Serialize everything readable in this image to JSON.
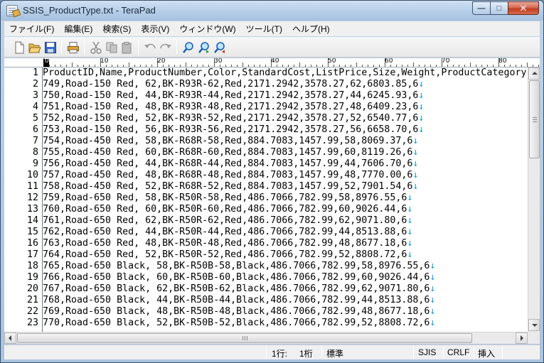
{
  "window": {
    "title": "SSIS_ProductType.txt - TeraPad"
  },
  "window_buttons": {
    "minimize": "—",
    "maximize": "□",
    "close": "✕"
  },
  "menu": [
    "ファイル(F)",
    "編集(E)",
    "検索(S)",
    "表示(V)",
    "ウィンドウ(W)",
    "ツール(T)",
    "ヘルプ(H)"
  ],
  "toolbar_icons": [
    "new-file-icon",
    "open-folder-icon",
    "save-icon",
    "print-icon",
    "cut-icon",
    "copy-icon",
    "paste-icon",
    "undo-icon",
    "redo-icon",
    "find-icon",
    "find-next-icon",
    "find-previous-icon"
  ],
  "ruler": {
    "labels": [
      "0",
      "10",
      "20",
      "30",
      "40",
      "50",
      "60",
      "70",
      "80"
    ]
  },
  "editor": {
    "eol_mark": "↓",
    "lines": [
      {
        "n": "1",
        "text": "ProductID,Name,ProductNumber,Color,StandardCost,ListPrice,Size,Weight,ProductCategory",
        "eol": false
      },
      {
        "n": "2",
        "text": "749,Road-150 Red, 62,BK-R93R-62,Red,2171.2942,3578.27,62,6803.85,6",
        "eol": true
      },
      {
        "n": "3",
        "text": "750,Road-150 Red, 44,BK-R93R-44,Red,2171.2942,3578.27,44,6245.93,6",
        "eol": true
      },
      {
        "n": "4",
        "text": "751,Road-150 Red, 48,BK-R93R-48,Red,2171.2942,3578.27,48,6409.23,6",
        "eol": true
      },
      {
        "n": "5",
        "text": "752,Road-150 Red, 52,BK-R93R-52,Red,2171.2942,3578.27,52,6540.77,6",
        "eol": true
      },
      {
        "n": "6",
        "text": "753,Road-150 Red, 56,BK-R93R-56,Red,2171.2942,3578.27,56,6658.70,6",
        "eol": true
      },
      {
        "n": "7",
        "text": "754,Road-450 Red, 58,BK-R68R-58,Red,884.7083,1457.99,58,8069.37,6",
        "eol": true
      },
      {
        "n": "8",
        "text": "755,Road-450 Red, 60,BK-R68R-60,Red,884.7083,1457.99,60,8119.26,6",
        "eol": true
      },
      {
        "n": "9",
        "text": "756,Road-450 Red, 44,BK-R68R-44,Red,884.7083,1457.99,44,7606.70,6",
        "eol": true
      },
      {
        "n": "10",
        "text": "757,Road-450 Red, 48,BK-R68R-48,Red,884.7083,1457.99,48,7770.00,6",
        "eol": true
      },
      {
        "n": "11",
        "text": "758,Road-450 Red, 52,BK-R68R-52,Red,884.7083,1457.99,52,7901.54,6",
        "eol": true
      },
      {
        "n": "12",
        "text": "759,Road-650 Red, 58,BK-R50R-58,Red,486.7066,782.99,58,8976.55,6",
        "eol": true
      },
      {
        "n": "13",
        "text": "760,Road-650 Red, 60,BK-R50R-60,Red,486.7066,782.99,60,9026.44,6",
        "eol": true
      },
      {
        "n": "14",
        "text": "761,Road-650 Red, 62,BK-R50R-62,Red,486.7066,782.99,62,9071.80,6",
        "eol": true
      },
      {
        "n": "15",
        "text": "762,Road-650 Red, 44,BK-R50R-44,Red,486.7066,782.99,44,8513.88,6",
        "eol": true
      },
      {
        "n": "16",
        "text": "763,Road-650 Red, 48,BK-R50R-48,Red,486.7066,782.99,48,8677.18,6",
        "eol": true
      },
      {
        "n": "17",
        "text": "764,Road-650 Red, 52,BK-R50R-52,Red,486.7066,782.99,52,8808.72,6",
        "eol": true
      },
      {
        "n": "18",
        "text": "765,Road-650 Black, 58,BK-R50B-58,Black,486.7066,782.99,58,8976.55,6",
        "eol": true
      },
      {
        "n": "19",
        "text": "766,Road-650 Black, 60,BK-R50B-60,Black,486.7066,782.99,60,9026.44,6",
        "eol": true
      },
      {
        "n": "20",
        "text": "767,Road-650 Black, 62,BK-R50B-62,Black,486.7066,782.99,62,9071.80,6",
        "eol": true
      },
      {
        "n": "21",
        "text": "768,Road-650 Black, 44,BK-R50B-44,Black,486.7066,782.99,44,8513.88,6",
        "eol": true
      },
      {
        "n": "22",
        "text": "769,Road-650 Black, 48,BK-R50B-48,Black,486.7066,782.99,48,8677.18,6",
        "eol": true
      },
      {
        "n": "23",
        "text": "770,Road-650 Black, 52,BK-R50B-52,Black,486.7066,782.99,52,8808.72,6",
        "eol": true
      }
    ]
  },
  "status": {
    "line": "1行:",
    "column": "1桁",
    "mode": "標準",
    "encoding": "SJIS",
    "newline": "CRLF",
    "insert": "挿入"
  },
  "colors": {
    "eol_mark": "#1a9bd7",
    "gutter_border": "#6c7a8a"
  }
}
